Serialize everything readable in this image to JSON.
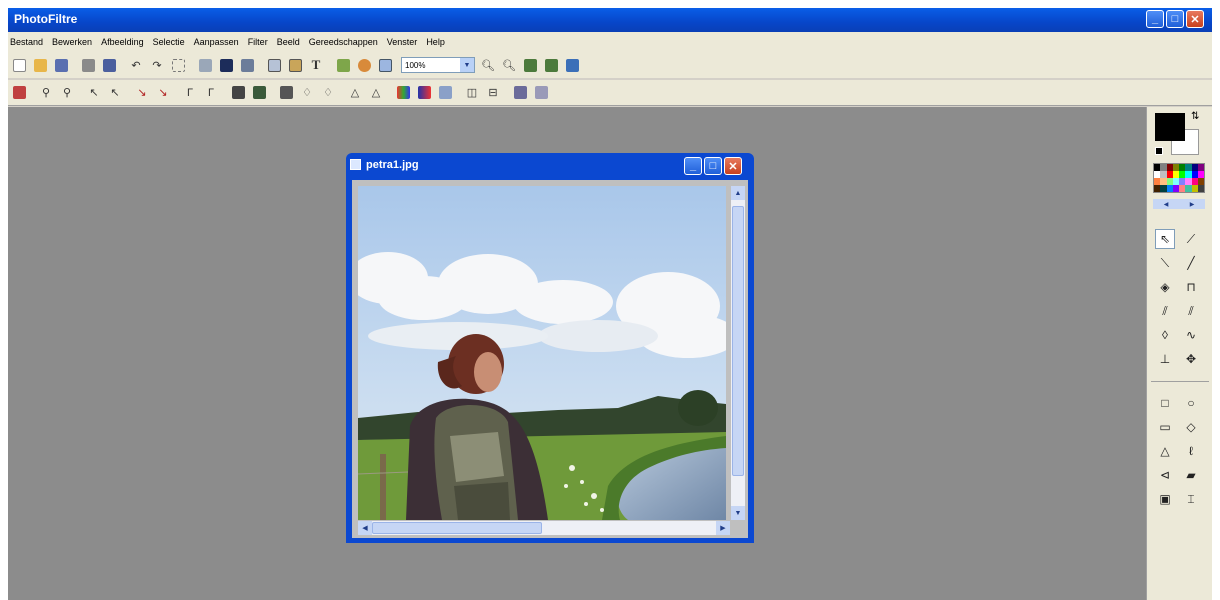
{
  "app": {
    "title": "PhotoFiltre",
    "colors": {
      "titlebar": "#0746c9",
      "workspace": "#8c8c8c",
      "chrome": "#ece9d8"
    }
  },
  "window_controls": {
    "minimize": "_",
    "maximize": "□",
    "close": "✕"
  },
  "menu": [
    "Bestand",
    "Bewerken",
    "Afbeelding",
    "Selectie",
    "Aanpassen",
    "Filter",
    "Beeld",
    "Gereedschappen",
    "Venster",
    "Help"
  ],
  "toolbar": {
    "zoom_value": "100%",
    "row1_icons": [
      "new-icon",
      "open-icon",
      "save-icon",
      "print-icon",
      "scan-icon",
      "undo-icon",
      "redo-icon",
      "crop-icon",
      "image-size-icon",
      "canvas-size-icon",
      "resize-icon",
      "copy-icon",
      "paste-icon",
      "text-icon",
      "layers-icon",
      "effects-icon",
      "frame-icon"
    ],
    "row1_after_zoom": [
      "zoom-in-icon",
      "zoom-out-icon",
      "fit-icon",
      "fullscreen-icon",
      "display-icon"
    ],
    "row2_icons": [
      "auto-levels-icon",
      "auto-contrast-icon",
      "brightness-plus-icon",
      "brightness-minus-icon",
      "contrast-plus-icon",
      "contrast-minus-icon",
      "saturation-plus-icon",
      "saturation-minus-icon",
      "gamma-plus-icon",
      "gamma-minus-icon",
      "grayscale-icon",
      "sepia-icon",
      "blur-icon",
      "soften-icon",
      "sharpen-icon",
      "sharpen-more-icon",
      "emboss-icon",
      "rgb-icon",
      "hue-icon",
      "flip-icon",
      "rotate-icon",
      "transform-icon",
      "plugin-icon",
      "batch-icon"
    ]
  },
  "document": {
    "title": "petra1.jpg",
    "scroll": {
      "vertical_position": 0.0,
      "horizontal_position": 0.0
    }
  },
  "palette": {
    "foreground_color": "#000000",
    "background_color": "#ffffff",
    "swatch_colors": [
      "#000000",
      "#808080",
      "#800000",
      "#808000",
      "#008000",
      "#008080",
      "#000080",
      "#800080",
      "#ffffff",
      "#c0c0c0",
      "#ff0000",
      "#ffff00",
      "#00ff00",
      "#00ffff",
      "#0000ff",
      "#ff00ff",
      "#ff8040",
      "#ffc080",
      "#80ff80",
      "#80ffff",
      "#8080ff",
      "#ff80ff",
      "#ff0080",
      "#804000",
      "#402000",
      "#004040",
      "#0080ff",
      "#8000ff",
      "#ff8080",
      "#40c0a0",
      "#c0c000",
      "#404040"
    ],
    "tools": [
      "pointer-icon",
      "eyedropper-icon",
      "magic-wand-icon",
      "line-icon",
      "fill-icon",
      "spray-icon",
      "brush-icon",
      "effect-brush-icon",
      "blur-drop-icon",
      "smudge-icon",
      "clone-stamp-icon",
      "move-icon"
    ],
    "shapes": [
      "rectangle-icon",
      "ellipse-icon",
      "rounded-rect-icon",
      "diamond-icon",
      "triangle-icon",
      "lasso-icon",
      "polygon-icon",
      "load-shape-icon",
      "invert-selection-icon",
      "text-mask-icon"
    ]
  }
}
